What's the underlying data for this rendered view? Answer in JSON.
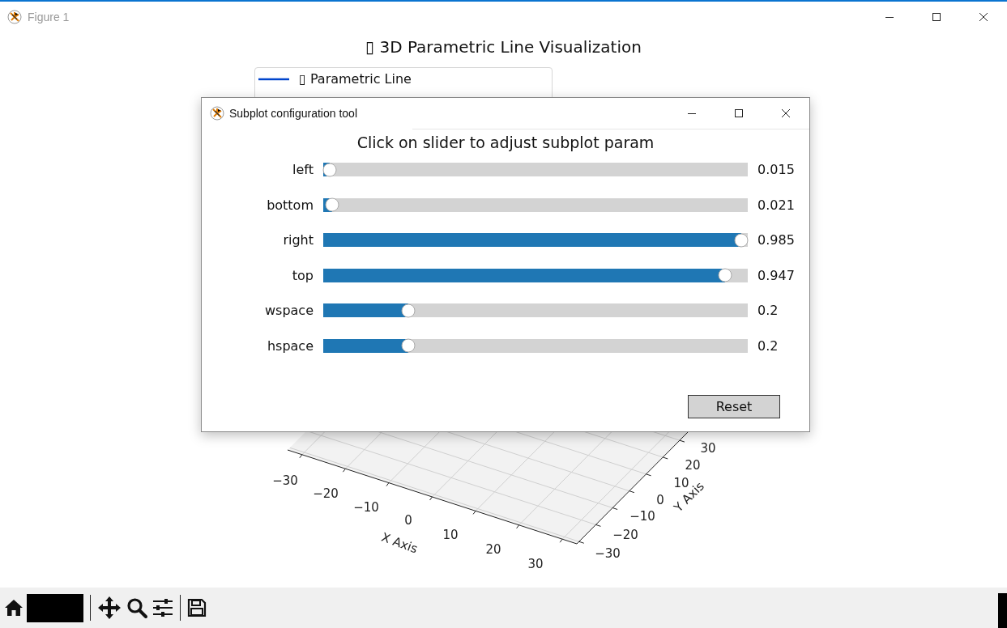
{
  "window": {
    "title": "Figure 1"
  },
  "figure": {
    "title": "▯ 3D Parametric Line Visualization",
    "legend": [
      {
        "label": "▯ Parametric Line"
      }
    ],
    "x_axis": {
      "label": "X Axis",
      "ticks": [
        "−30",
        "−20",
        "−10",
        "0",
        "10",
        "20",
        "30"
      ]
    },
    "y_axis": {
      "label": "Y Axis",
      "ticks": [
        "30",
        "20",
        "10",
        "0",
        "−10",
        "−20",
        "−30"
      ]
    }
  },
  "dialog": {
    "title": "Subplot configuration tool",
    "heading": "Click on slider to adjust subplot param",
    "sliders": [
      {
        "label": "left",
        "level": 0.015,
        "reading": "0.015"
      },
      {
        "label": "bottom",
        "level": 0.021,
        "reading": "0.021"
      },
      {
        "label": "right",
        "level": 0.985,
        "reading": "0.985"
      },
      {
        "label": "top",
        "level": 0.947,
        "reading": "0.947"
      },
      {
        "label": "wspace",
        "level": 0.2,
        "reading": "0.2"
      },
      {
        "label": "hspace",
        "level": 0.2,
        "reading": "0.2"
      }
    ],
    "buttons": [
      "Reset"
    ]
  }
}
